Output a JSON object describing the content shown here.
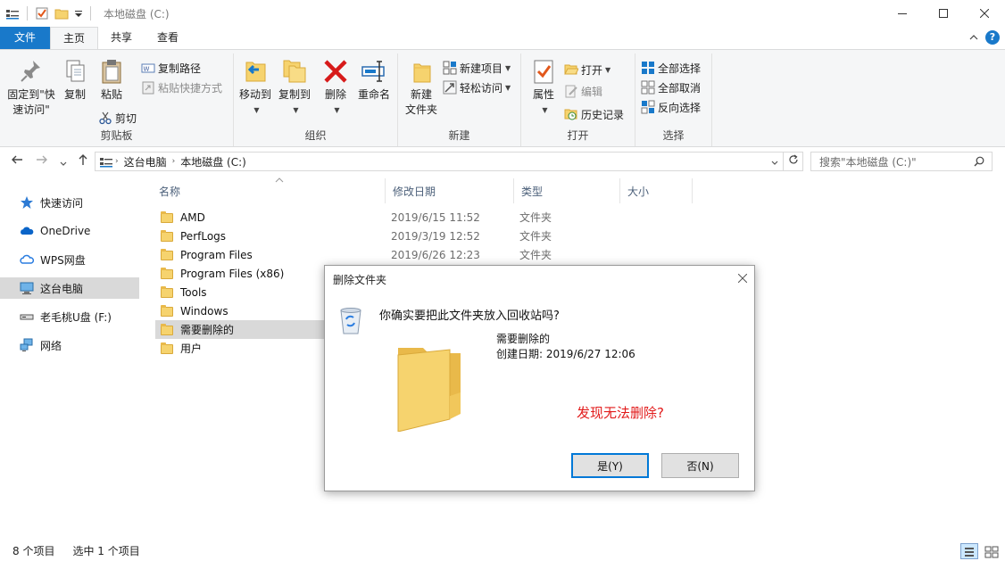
{
  "window": {
    "title": "本地磁盘 (C:)"
  },
  "tabs": [
    {
      "label": "文件"
    },
    {
      "label": "主页"
    },
    {
      "label": "共享"
    },
    {
      "label": "查看"
    }
  ],
  "ribbon": {
    "clipboard": {
      "label": "剪贴板",
      "pin_line1": "固定到\"快",
      "pin_line2": "速访问\"",
      "copy": "复制",
      "paste": "粘贴",
      "copy_path": "复制路径",
      "paste_shortcut": "粘贴快捷方式",
      "cut": "剪切"
    },
    "organize": {
      "label": "组织",
      "move_to": "移动到",
      "copy_to": "复制到",
      "delete": "删除",
      "rename": "重命名"
    },
    "new": {
      "label": "新建",
      "new_folder_line1": "新建",
      "new_folder_line2": "文件夹",
      "new_item": "新建项目",
      "easy_access": "轻松访问"
    },
    "open": {
      "label": "打开",
      "properties": "属性",
      "open": "打开",
      "edit": "编辑",
      "history": "历史记录"
    },
    "select": {
      "label": "选择",
      "select_all": "全部选择",
      "select_none": "全部取消",
      "invert": "反向选择"
    }
  },
  "address": {
    "crumbs": [
      "这台电脑",
      "本地磁盘 (C:)"
    ],
    "search_placeholder": "搜索\"本地磁盘 (C:)\""
  },
  "nav": {
    "items": [
      {
        "label": "快速访问",
        "icon": "star-icon"
      },
      {
        "label": "OneDrive",
        "icon": "cloud-icon"
      },
      {
        "label": "WPS网盘",
        "icon": "wps-cloud-icon"
      },
      {
        "label": "这台电脑",
        "icon": "computer-icon",
        "selected": true
      },
      {
        "label": "老毛桃U盘 (F:)",
        "icon": "usb-drive-icon"
      },
      {
        "label": "网络",
        "icon": "network-icon"
      }
    ]
  },
  "filelist": {
    "columns": [
      "名称",
      "修改日期",
      "类型",
      "大小"
    ],
    "rows": [
      {
        "name": "AMD",
        "date": "2019/6/15 11:52",
        "type": "文件夹"
      },
      {
        "name": "PerfLogs",
        "date": "2019/3/19 12:52",
        "type": "文件夹"
      },
      {
        "name": "Program Files",
        "date": "2019/6/26 12:23",
        "type": "文件夹"
      },
      {
        "name": "Program Files (x86)",
        "date": "",
        "type": ""
      },
      {
        "name": "Tools",
        "date": "",
        "type": ""
      },
      {
        "name": "Windows",
        "date": "",
        "type": ""
      },
      {
        "name": "需要删除的",
        "date": "",
        "type": "",
        "selected": true
      },
      {
        "name": "用户",
        "date": "",
        "type": ""
      }
    ]
  },
  "status": {
    "count": "8 个项目",
    "selected": "选中 1 个项目"
  },
  "dialog": {
    "title": "删除文件夹",
    "question": "你确实要把此文件夹放入回收站吗?",
    "folder_name": "需要删除的",
    "created": "创建日期: 2019/6/27 12:06",
    "annotation": "发现无法删除?",
    "yes": "是(Y)",
    "no": "否(N)"
  },
  "colors": {
    "accent": "#1979ca",
    "selection": "#d9d9d9",
    "annotation": "#e21b1b"
  }
}
